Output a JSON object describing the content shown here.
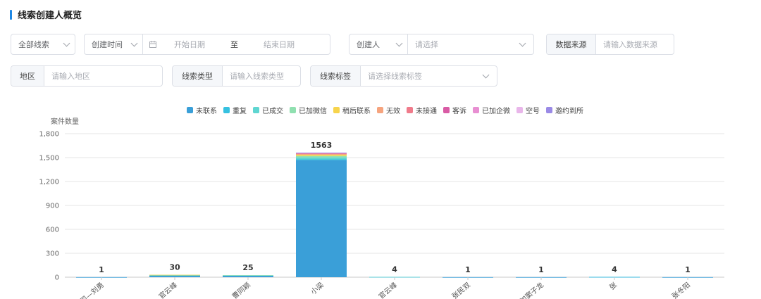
{
  "header": {
    "title": "线索创建人概览"
  },
  "filters": {
    "all_leads": "全部线索",
    "create_time": "创建时间",
    "start_date": "开始日期",
    "date_sep": "至",
    "end_date": "结束日期",
    "creator": "创建人",
    "creator_placeholder": "请选择",
    "data_source_label": "数据来源",
    "data_source_placeholder": "请输入数据来源",
    "region_label": "地区",
    "region_placeholder": "请输入地区",
    "lead_type_label": "线索类型",
    "lead_type_placeholder": "请输入线索类型",
    "lead_tag_label": "线索标签",
    "lead_tag_placeholder": "请选择线索标签"
  },
  "chart_data": {
    "type": "bar",
    "stacked": true,
    "ylabel": "案件数量",
    "ylim": [
      0,
      1800
    ],
    "yticks": [
      "0",
      "300",
      "600",
      "900",
      "1,200",
      "1,500",
      "1,800"
    ],
    "grid": true,
    "legend_position": "top",
    "categories": [
      "…司—刘勇",
      "…官云峰",
      "曹同颖",
      "小梁",
      "…官云峰",
      "张民双",
      "…加窦子龙",
      "张",
      "张冬阳"
    ],
    "totals": [
      1,
      30,
      25,
      1563,
      4,
      1,
      1,
      4,
      1
    ],
    "series": [
      {
        "name": "未联系",
        "color": "#3a9fd8",
        "values": [
          1,
          18,
          22,
          1470,
          3,
          1,
          1,
          3,
          1
        ]
      },
      {
        "name": "重复",
        "color": "#36c1e0",
        "values": [
          0,
          5,
          2,
          8,
          0,
          0,
          0,
          1,
          0
        ]
      },
      {
        "name": "已成交",
        "color": "#5fd6d1",
        "values": [
          0,
          4,
          0,
          25,
          1,
          0,
          0,
          0,
          0
        ]
      },
      {
        "name": "已加微信",
        "color": "#90e0b0",
        "values": [
          0,
          2,
          1,
          18,
          0,
          0,
          0,
          0,
          0
        ]
      },
      {
        "name": "稍后联系",
        "color": "#f7d44c",
        "values": [
          0,
          1,
          0,
          14,
          0,
          0,
          0,
          0,
          0
        ]
      },
      {
        "name": "无效",
        "color": "#f6a47e",
        "values": [
          0,
          0,
          0,
          10,
          0,
          0,
          0,
          0,
          0
        ]
      },
      {
        "name": "未接通",
        "color": "#f07b8b",
        "values": [
          0,
          0,
          0,
          8,
          0,
          0,
          0,
          0,
          0
        ]
      },
      {
        "name": "客诉",
        "color": "#d95ba5",
        "values": [
          0,
          0,
          0,
          4,
          0,
          0,
          0,
          0,
          0
        ]
      },
      {
        "name": "已加企微",
        "color": "#e88fd2",
        "values": [
          0,
          0,
          0,
          3,
          0,
          0,
          0,
          0,
          0
        ]
      },
      {
        "name": "空号",
        "color": "#e9b6ea",
        "values": [
          0,
          0,
          0,
          2,
          0,
          0,
          0,
          0,
          0
        ]
      },
      {
        "name": "邀约到所",
        "color": "#9a8ae6",
        "values": [
          0,
          0,
          0,
          1,
          0,
          0,
          0,
          0,
          0
        ]
      }
    ]
  }
}
